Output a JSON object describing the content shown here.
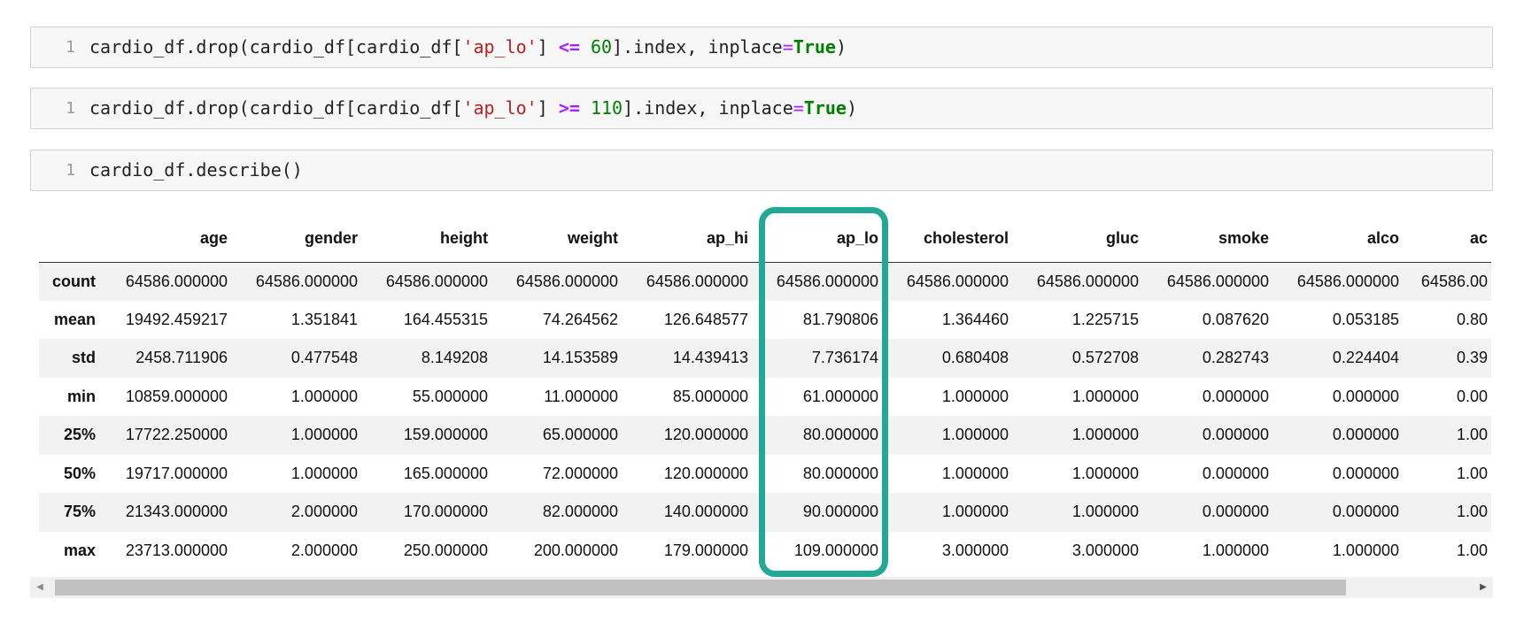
{
  "cells": [
    {
      "line_number": "1",
      "tokens": [
        {
          "text": "cardio_df.drop(cardio_df[cardio_df[",
          "cls": ""
        },
        {
          "text": "'ap_lo'",
          "cls": "tok-str"
        },
        {
          "text": "] ",
          "cls": ""
        },
        {
          "text": "<=",
          "cls": "tok-op"
        },
        {
          "text": " ",
          "cls": ""
        },
        {
          "text": "60",
          "cls": "tok-num"
        },
        {
          "text": "].index, inplace",
          "cls": ""
        },
        {
          "text": "=",
          "cls": "tok-eq"
        },
        {
          "text": "True",
          "cls": "tok-kw"
        },
        {
          "text": ")",
          "cls": ""
        }
      ]
    },
    {
      "line_number": "1",
      "tokens": [
        {
          "text": "cardio_df.drop(cardio_df[cardio_df[",
          "cls": ""
        },
        {
          "text": "'ap_lo'",
          "cls": "tok-str"
        },
        {
          "text": "] ",
          "cls": ""
        },
        {
          "text": ">=",
          "cls": "tok-op"
        },
        {
          "text": " ",
          "cls": ""
        },
        {
          "text": "110",
          "cls": "tok-num"
        },
        {
          "text": "].index, inplace",
          "cls": ""
        },
        {
          "text": "=",
          "cls": "tok-eq"
        },
        {
          "text": "True",
          "cls": "tok-kw"
        },
        {
          "text": ")",
          "cls": ""
        }
      ]
    },
    {
      "line_number": "1",
      "tokens": [
        {
          "text": "cardio_df.describe()",
          "cls": ""
        }
      ]
    }
  ],
  "table": {
    "columns": [
      "age",
      "gender",
      "height",
      "weight",
      "ap_hi",
      "ap_lo",
      "cholesterol",
      "gluc",
      "smoke",
      "alco",
      "ac"
    ],
    "rows": [
      {
        "label": "count",
        "values": [
          "64586.000000",
          "64586.000000",
          "64586.000000",
          "64586.000000",
          "64586.000000",
          "64586.000000",
          "64586.000000",
          "64586.000000",
          "64586.000000",
          "64586.000000",
          "64586.00"
        ]
      },
      {
        "label": "mean",
        "values": [
          "19492.459217",
          "1.351841",
          "164.455315",
          "74.264562",
          "126.648577",
          "81.790806",
          "1.364460",
          "1.225715",
          "0.087620",
          "0.053185",
          "0.80"
        ]
      },
      {
        "label": "std",
        "values": [
          "2458.711906",
          "0.477548",
          "8.149208",
          "14.153589",
          "14.439413",
          "7.736174",
          "0.680408",
          "0.572708",
          "0.282743",
          "0.224404",
          "0.39"
        ]
      },
      {
        "label": "min",
        "values": [
          "10859.000000",
          "1.000000",
          "55.000000",
          "11.000000",
          "85.000000",
          "61.000000",
          "1.000000",
          "1.000000",
          "0.000000",
          "0.000000",
          "0.00"
        ]
      },
      {
        "label": "25%",
        "values": [
          "17722.250000",
          "1.000000",
          "159.000000",
          "65.000000",
          "120.000000",
          "80.000000",
          "1.000000",
          "1.000000",
          "0.000000",
          "0.000000",
          "1.00"
        ]
      },
      {
        "label": "50%",
        "values": [
          "19717.000000",
          "1.000000",
          "165.000000",
          "72.000000",
          "120.000000",
          "80.000000",
          "1.000000",
          "1.000000",
          "0.000000",
          "0.000000",
          "1.00"
        ]
      },
      {
        "label": "75%",
        "values": [
          "21343.000000",
          "2.000000",
          "170.000000",
          "82.000000",
          "140.000000",
          "90.000000",
          "1.000000",
          "1.000000",
          "0.000000",
          "0.000000",
          "1.00"
        ]
      },
      {
        "label": "max",
        "values": [
          "23713.000000",
          "2.000000",
          "250.000000",
          "200.000000",
          "179.000000",
          "109.000000",
          "3.000000",
          "3.000000",
          "1.000000",
          "1.000000",
          "1.00"
        ]
      }
    ],
    "highlighted_column": "ap_lo"
  },
  "scrollbar": {
    "left_arrow": "◀",
    "right_arrow": "▶",
    "position_fraction": 0.0
  },
  "colors": {
    "highlight": "#22a894",
    "string": "#ba2121",
    "operator": "#aa22ff",
    "number": "#008000",
    "keyword": "#008000"
  }
}
